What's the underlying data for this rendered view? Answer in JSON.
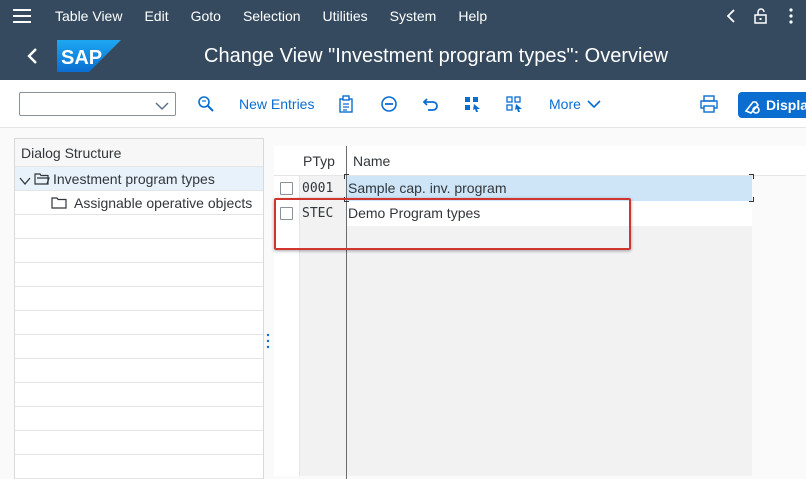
{
  "menu": {
    "items": [
      {
        "label": "Table View"
      },
      {
        "label": "Edit"
      },
      {
        "label": "Goto"
      },
      {
        "label": "Selection"
      },
      {
        "label": "Utilities"
      },
      {
        "label": "System"
      },
      {
        "label": "Help"
      }
    ]
  },
  "title_bar": {
    "logo_text": "SAP",
    "title": "Change View \"Investment program types\": Overview"
  },
  "toolbar": {
    "command_value": "",
    "new_entries_label": "New Entries",
    "more_label": "More",
    "display_label": "Display"
  },
  "dialog_structure": {
    "header": "Dialog Structure",
    "items": [
      {
        "label": "Investment program types",
        "selected": true
      },
      {
        "label": "Assignable operative objects",
        "selected": false
      }
    ]
  },
  "table": {
    "columns": [
      "PTyp",
      "Name"
    ],
    "rows": [
      {
        "ptyp": "0001",
        "name": "Sample cap. inv. program"
      },
      {
        "ptyp": "STEC",
        "name": "Demo Program types"
      }
    ]
  },
  "colors": {
    "shell": "#354a5f",
    "accent": "#0a6ed1",
    "selection": "#cde5f7",
    "highlight": "#d0352f"
  }
}
